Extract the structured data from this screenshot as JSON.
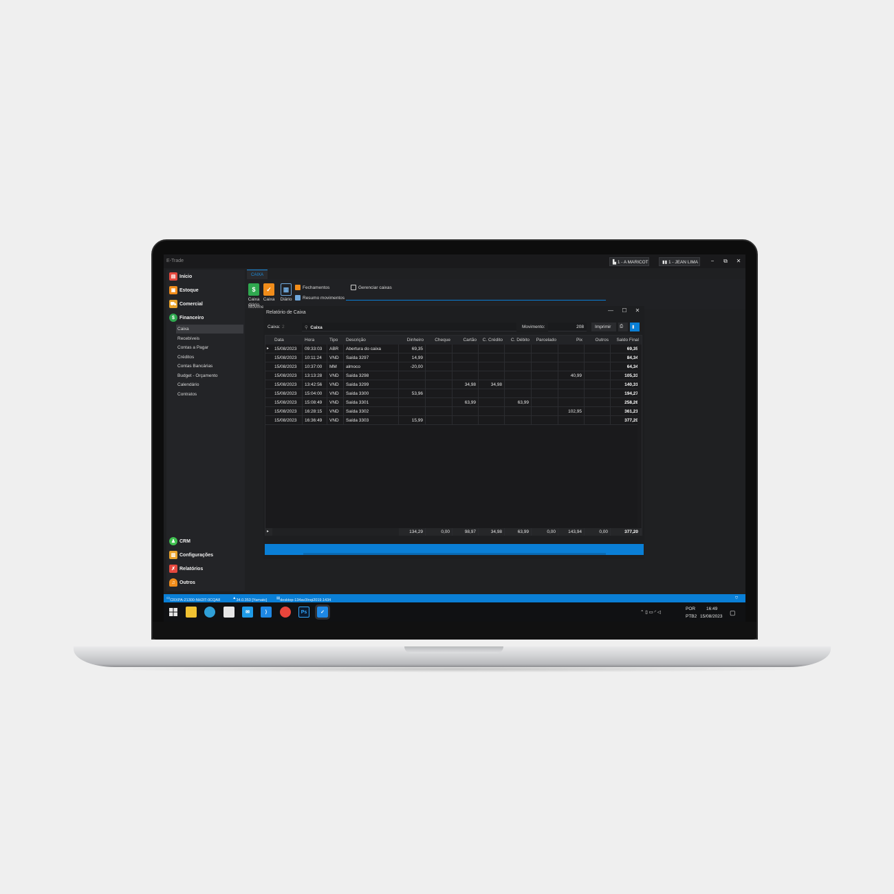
{
  "app": {
    "title": "E-Trade",
    "user_company": "1 - A MARICOT",
    "user_name": "1 - JEAN LIMA",
    "minimize": "−",
    "restore": "⧉",
    "close": "✕"
  },
  "sidebar": {
    "items": [
      {
        "label": "Início",
        "icon": "store-icon",
        "color": "#e5483e"
      },
      {
        "label": "Estoque",
        "icon": "box-icon",
        "color": "#f08c1a"
      },
      {
        "label": "Comercial",
        "icon": "shopping-cart-icon",
        "color": "#e9a32b"
      },
      {
        "label": "Financeiro",
        "icon": "dollar-icon",
        "color": "#2fa84f"
      }
    ],
    "financeiro_subitems": [
      "Caixa",
      "Recebíveis",
      "Contas a Pagar",
      "Créditos",
      "Contas Bancárias",
      "Budget - Orçamento",
      "Calendário",
      "Contratos"
    ],
    "bottom_items": [
      {
        "label": "CRM",
        "icon": "users-icon",
        "color": "#3fbf4f"
      },
      {
        "label": "Configurações",
        "icon": "settings-chart-icon",
        "color": "#e9a32b"
      },
      {
        "label": "Relatórios",
        "icon": "report-icon",
        "color": "#e5483e"
      },
      {
        "label": "Outros",
        "icon": "bell-icon",
        "color": "#f08c1a"
      }
    ]
  },
  "ribbon": {
    "tab": "CAIXA",
    "caixa_diario": "Caixa diário",
    "caixa": "Caixa",
    "diario": "Diário",
    "fechamentos": "Fechamentos",
    "resumo_movimentos": "Resumo movimentos",
    "gerenciar_caixas": "Gerenciar caixas",
    "group_label": "Movime"
  },
  "dialog": {
    "title": "Relatório de Caixa",
    "minimize": "—",
    "maximize": "☐",
    "close": "✕",
    "caixa_label": "Caixa:",
    "caixa_value": "2",
    "caixa_name": "Caixa",
    "movimento_label": "Movimento:",
    "movimento_value": "208",
    "imprimir": "Imprimir"
  },
  "table": {
    "columns": [
      "Data",
      "Hora",
      "Tipo",
      "Descrição",
      "Dinheiro",
      "Cheque",
      "Cartão",
      "C. Crédito",
      "C. Débito",
      "Parcelado",
      "Pix",
      "Outros",
      "Saldo Final"
    ],
    "rows": [
      [
        "15/08/2023",
        "09:33:03",
        "ABR",
        "Abertura do caixa",
        "69,35",
        "",
        "",
        "",
        "",
        "",
        "",
        "",
        "69,35"
      ],
      [
        "15/08/2023",
        "10:11:24",
        "VND",
        "Saída 3297",
        "14,99",
        "",
        "",
        "",
        "",
        "",
        "",
        "",
        "84,34"
      ],
      [
        "15/08/2023",
        "10:37:00",
        "MM",
        "almoco",
        "-20,00",
        "",
        "",
        "",
        "",
        "",
        "",
        "",
        "64,34"
      ],
      [
        "15/08/2023",
        "13:13:28",
        "VND",
        "Saída 3298",
        "",
        "",
        "",
        "",
        "",
        "",
        "40,99",
        "",
        "105,33"
      ],
      [
        "15/08/2023",
        "13:42:56",
        "VND",
        "Saída 3299",
        "",
        "",
        "34,98",
        "34,98",
        "",
        "",
        "",
        "",
        "140,31"
      ],
      [
        "15/08/2023",
        "15:04:00",
        "VND",
        "Saída 3300",
        "53,96",
        "",
        "",
        "",
        "",
        "",
        "",
        "",
        "194,27"
      ],
      [
        "15/08/2023",
        "15:08:49",
        "VND",
        "Saída 3301",
        "",
        "",
        "63,99",
        "",
        "63,99",
        "",
        "",
        "",
        "258,26"
      ],
      [
        "15/08/2023",
        "16:28:15",
        "VND",
        "Saída 3302",
        "",
        "",
        "",
        "",
        "",
        "",
        "102,95",
        "",
        "361,21"
      ],
      [
        "15/08/2023",
        "16:36:49",
        "VND",
        "Saída 3303",
        "15,99",
        "",
        "",
        "",
        "",
        "",
        "",
        "",
        "377,20"
      ]
    ],
    "totals": [
      "134,29",
      "0,00",
      "98,97",
      "34,98",
      "63,99",
      "0,00",
      "143,94",
      "0,00",
      "377,20"
    ]
  },
  "status_bar": {
    "machine": "CRXPA-21300-NH2IT-0CQA8",
    "version": "34.0.353 [Yamato]",
    "database": "desktop-134av3Inqi2019.1434"
  },
  "taskbar": {
    "apps": [
      {
        "name": "windows-start-icon",
        "color": "#1e9be8"
      },
      {
        "name": "file-explorer-icon",
        "color": "#f1c232"
      },
      {
        "name": "edge-browser-icon",
        "color": "#2fa0d8"
      },
      {
        "name": "store-app-icon",
        "color": "#ffffff"
      },
      {
        "name": "mail-icon",
        "color": "#1e9be8"
      },
      {
        "name": "vscode-icon",
        "color": "#1e88e5"
      },
      {
        "name": "chrome-icon",
        "color": "#e8453c"
      },
      {
        "name": "photoshop-icon",
        "color": "#31a8ff"
      },
      {
        "name": "etrade-app-icon",
        "color": "#1e88e5"
      }
    ],
    "lang_top": "POR",
    "lang_bottom": "PTB2",
    "time": "16:49",
    "date": "15/08/2023"
  }
}
